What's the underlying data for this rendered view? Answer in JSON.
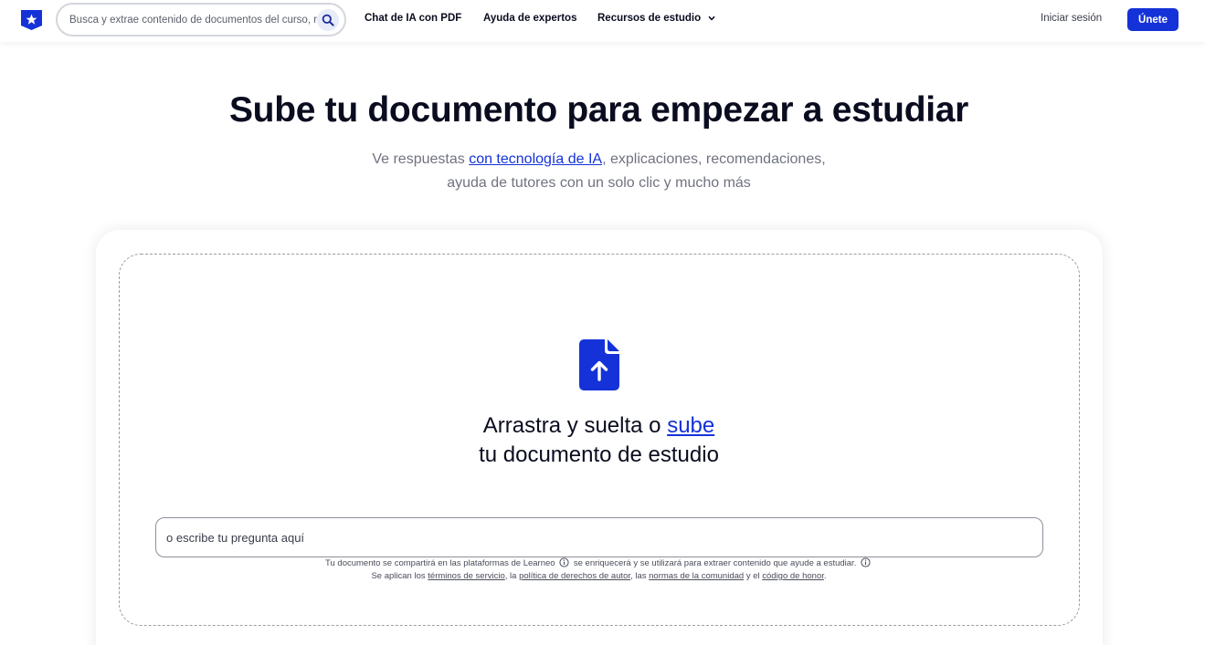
{
  "header": {
    "search": {
      "placeholder": "Busca y extrae contenido de documentos del curso, recursos de estudio y más"
    },
    "nav": {
      "ai_chat": "Chat de IA con PDF",
      "experts": "Ayuda de expertos",
      "resources": "Recursos de estudio"
    },
    "login": "Iniciar sesión",
    "join": "Únete"
  },
  "hero": {
    "title": "Sube tu documento para empezar a estudiar",
    "subtitle_line1_before": "Ve respuestas ",
    "subtitle_link": "con tecnología de IA",
    "subtitle_line1_after": ", explicaciones, recomendaciones,",
    "subtitle_line2": "ayuda de tutores con un solo clic y mucho más"
  },
  "upload": {
    "drag_text": "Arrastra y suelta o ",
    "upload_link": "sube",
    "doc_text": "tu documento de estudio",
    "question_placeholder": "o escribe tu pregunta aquí"
  },
  "legal": {
    "line1_a": "Tu documento se compartirá en las plataformas de Learneo",
    "line1_b": " se enriquecerá y se utilizará para extraer contenido que ayude a estudiar.",
    "line2_a": "Se aplican los ",
    "terms": "términos de servicio",
    "sep1": ", la ",
    "copyright": "política de derechos de autor",
    "sep2": ", las ",
    "community": "normas de la comunidad",
    "sep3": " y el ",
    "honor": "código de honor",
    "end": "."
  },
  "colors": {
    "brand": "#1432d8",
    "text": "#0a0c1f",
    "muted": "#707380"
  }
}
